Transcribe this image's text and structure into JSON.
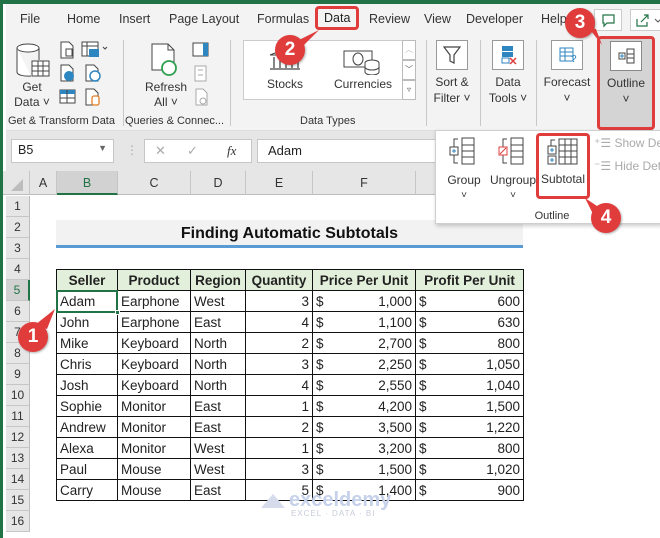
{
  "ribbon_tabs": [
    "File",
    "Home",
    "Insert",
    "Page Layout",
    "Formulas",
    "Data",
    "Review",
    "View",
    "Developer",
    "Help"
  ],
  "active_tab": "Data",
  "ribbon": {
    "get_data": {
      "line1": "Get",
      "line2": "Data ˅"
    },
    "get_transform_label": "Get & Transform Data",
    "refresh": {
      "line1": "Refresh",
      "line2": "All ˅"
    },
    "queries_label": "Queries & Connec...",
    "stocks": "Stocks",
    "currencies": "Currencies",
    "data_types_label": "Data Types",
    "sort_filter": {
      "line1": "Sort &",
      "line2": "Filter ˅"
    },
    "data_tools": {
      "line1": "Data",
      "line2": "Tools ˅"
    },
    "forecast": {
      "line1": "Forecast",
      "line2": "˅"
    },
    "outline": {
      "line1": "Outline",
      "line2": "˅"
    }
  },
  "outline_popup": {
    "group": "Group",
    "ungroup": "Ungroup",
    "subtotal": "Subtotal",
    "show_detail": "Show Detail",
    "hide_detail": "Hide Detail",
    "label": "Outline",
    "chev": "˅"
  },
  "formula_bar": {
    "name_box": "B5",
    "fx": "fx",
    "value": "Adam",
    "cancel": "✕",
    "enter": "✓"
  },
  "columns": [
    "A",
    "B",
    "C",
    "D",
    "E",
    "F"
  ],
  "rows": [
    "1",
    "2",
    "3",
    "4",
    "5",
    "6",
    "7",
    "8",
    "9",
    "10",
    "11",
    "12",
    "13",
    "14",
    "15",
    "16"
  ],
  "sheet_title": "Finding Automatic Subtotals",
  "table": {
    "headers": [
      "Seller",
      "Product",
      "Region",
      "Quantity",
      "Price Per Unit",
      "Profit Per Unit"
    ],
    "currency": "$",
    "rows": [
      [
        "Adam",
        "Earphone",
        "West",
        "3",
        "1,000",
        "600"
      ],
      [
        "John",
        "Earphone",
        "East",
        "4",
        "1,100",
        "630"
      ],
      [
        "Mike",
        "Keyboard",
        "North",
        "2",
        "2,700",
        "800"
      ],
      [
        "Chris",
        "Keyboard",
        "North",
        "3",
        "2,250",
        "1,050"
      ],
      [
        "Josh",
        "Keyboard",
        "North",
        "4",
        "2,550",
        "1,040"
      ],
      [
        "Sophie",
        "Monitor",
        "East",
        "1",
        "4,200",
        "1,500"
      ],
      [
        "Andrew",
        "Monitor",
        "East",
        "2",
        "3,500",
        "1,220"
      ],
      [
        "Alexa",
        "Monitor",
        "West",
        "1",
        "3,200",
        "800"
      ],
      [
        "Paul",
        "Mouse",
        "West",
        "3",
        "1,500",
        "1,020"
      ],
      [
        "Carry",
        "Mouse",
        "East",
        "5",
        "1,400",
        "900"
      ]
    ]
  },
  "annotations": [
    "1",
    "2",
    "3",
    "4"
  ],
  "watermark": {
    "name": "exceldemy",
    "tagline": "EXCEL · DATA · BI"
  },
  "colors": {
    "excel_green": "#217346",
    "annotation_red": "#e03c3c",
    "header_fill": "#e2efda",
    "title_border": "#5b9bd5"
  }
}
